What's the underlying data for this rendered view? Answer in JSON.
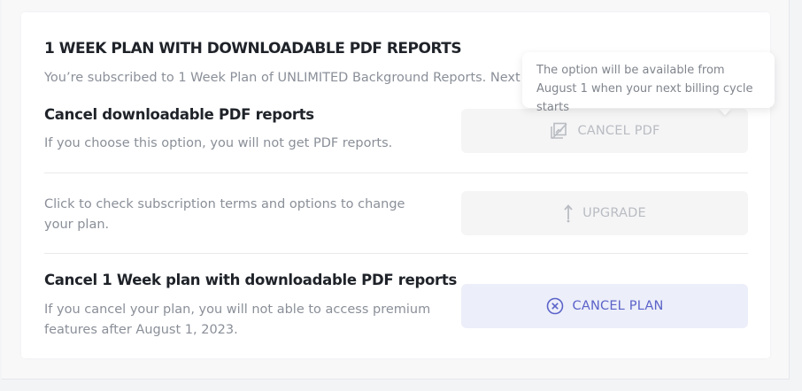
{
  "plan": {
    "title": "1 WEEK PLAN WITH DOWNLOADABLE PDF REPORTS",
    "subtitle": "You’re subscribed to 1 Week Plan of UNLIMITED Background Reports. Next b"
  },
  "cancel_pdf": {
    "title": "Cancel downloadable PDF reports",
    "description": "If you choose this option, you will not get PDF reports.",
    "button_label": "CANCEL PDF",
    "icon": "pdf-cancel-icon"
  },
  "upgrade": {
    "description": "Click to check subscription terms and options to change your plan.",
    "button_label": "UPGRADE",
    "icon": "arrow-up-icon"
  },
  "cancel_plan": {
    "title": "Cancel 1 Week plan with downloadable PDF reports",
    "description": "If you cancel your plan, you will not able to access premium features after August 1, 2023.",
    "button_label": "CANCEL PLAN",
    "icon": "circle-x-icon"
  },
  "tooltip": {
    "text": "The option will be available from August 1 when your next billing cycle starts"
  },
  "colors": {
    "accent": "#5b63c9",
    "disabled_text": "#b9bcc2",
    "title_text": "#1f2329",
    "muted_text": "#8a8f98"
  }
}
